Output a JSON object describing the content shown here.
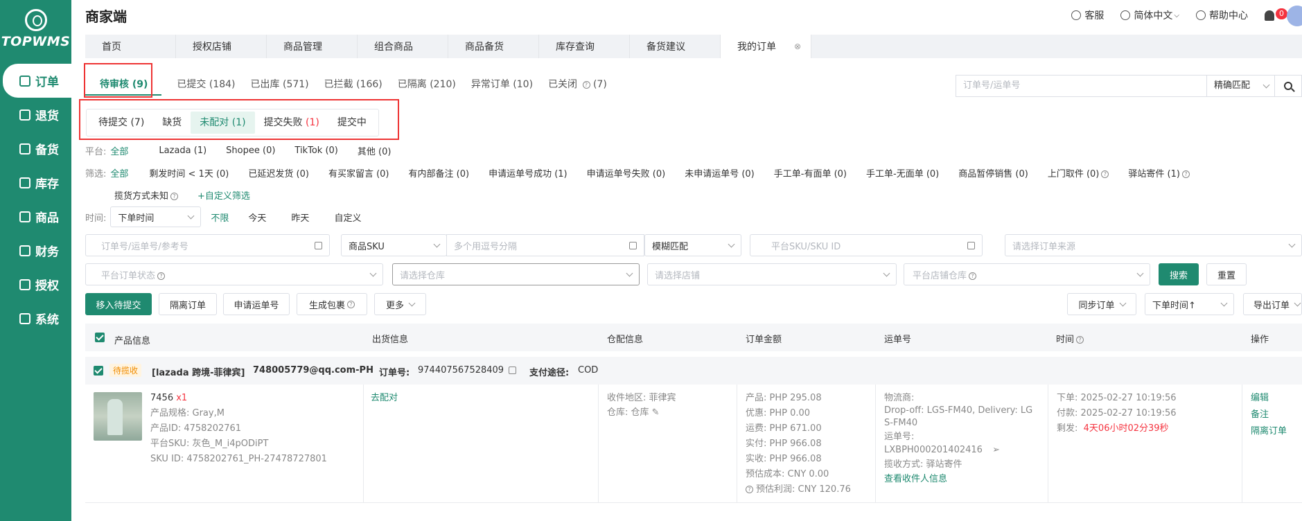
{
  "logo": {
    "text": "TOPWMS"
  },
  "sidebar": {
    "items": [
      {
        "label": "订单",
        "active": true
      },
      {
        "label": "退货"
      },
      {
        "label": "备货"
      },
      {
        "label": "库存"
      },
      {
        "label": "商品"
      },
      {
        "label": "财务"
      },
      {
        "label": "授权"
      },
      {
        "label": "系统"
      }
    ]
  },
  "header": {
    "title": "商家端",
    "service": "客服",
    "language": "简体中文",
    "help": "帮助中心",
    "notification_count": "0"
  },
  "page_tabs": [
    "首页",
    "授权店铺",
    "商品管理",
    "组合商品",
    "商品备货",
    "库存查询",
    "备货建议",
    "我的订单"
  ],
  "status_tabs": [
    "待审核 (9)",
    "已提交 (184)",
    "已出库 (571)",
    "已拦截 (166)",
    "已隔离 (210)",
    "异常订单 (10)",
    "已关闭",
    "(7)"
  ],
  "top_search": {
    "placeholder": "订单号/运单号",
    "mode": "精确匹配"
  },
  "sub_tabs": [
    "待提交 (7)",
    "缺货",
    "未配对 (1)",
    "提交失败",
    "(1)",
    "提交中"
  ],
  "platform_filter": {
    "label": "平台:",
    "options": [
      "全部",
      "Lazada (1)",
      "Shopee (0)",
      "TikTok (0)",
      "其他 (0)"
    ]
  },
  "screen_filter": {
    "label": "筛选:",
    "options": [
      "全部",
      "剩发时间 < 1天 (0)",
      "已延迟发货 (0)",
      "有买家留言 (0)",
      "有内部备注 (0)",
      "申请运单号成功 (1)",
      "申请运单号失败 (0)",
      "未申请运单号 (0)",
      "手工单-有面单 (0)",
      "手工单-无面单 (0)",
      "商品暂停销售 (0)",
      "上门取件 (0)",
      "驿站寄件 (1)"
    ],
    "row2": [
      "揽货方式未知",
      "+自定义筛选"
    ]
  },
  "time_filter": {
    "label": "时间:",
    "select": "下单时间",
    "options": [
      "不限",
      "今天",
      "昨天",
      "自定义"
    ]
  },
  "search_fields": {
    "order_placeholder": "订单号/运单号/参考号",
    "sku_select": "商品SKU",
    "sku_placeholder": "多个用逗号分隔",
    "match_select": "模糊匹配",
    "platform_sku_placeholder": "平台SKU/SKU ID",
    "source_placeholder": "请选择订单来源",
    "platform_status_placeholder": "平台订单状态",
    "warehouse_placeholder": "请选择仓库",
    "store_placeholder": "请选择店铺",
    "store_warehouse_placeholder": "平台店铺仓库",
    "search_btn": "搜索",
    "reset_btn": "重置"
  },
  "actions": {
    "move_pending": "移入待提交",
    "isolate": "隔离订单",
    "apply_waybill": "申请运单号",
    "gen_package": "生成包裹",
    "more": "更多",
    "sync": "同步订单",
    "sort": "下单时间↑",
    "export": "导出订单"
  },
  "table": {
    "headers": [
      "产品信息",
      "出货信息",
      "仓配信息",
      "订单金额",
      "运单号",
      "时间",
      "操作"
    ]
  },
  "order": {
    "status_tag": "待揽收",
    "store": "[lazada 跨境-菲律宾]",
    "account": "748005779@qq.com-PH",
    "order_no_label": "订单号:",
    "order_no": "974407567528409",
    "pay_label": "支付途径:",
    "pay": "COD",
    "product": {
      "name": "7456",
      "qty": "x1",
      "spec": "产品规格:  Gray,M",
      "id": "产品ID:  4758202761",
      "platform_sku": "平台SKU:  灰色_M_i4pODiPT",
      "sku_id": "SKU ID:  4758202761_PH-27478727801"
    },
    "ship": "去配对",
    "wh": {
      "region": "收件地区:  菲律宾",
      "warehouse": "仓库:  仓库"
    },
    "amount": [
      "产品:  PHP 295.08",
      "优惠:  PHP 0.00",
      "运费:  PHP 671.00",
      "实付:  PHP 966.08",
      "实收:  PHP 966.08",
      "预估成本:  CNY 0.00",
      "预估利润:  CNY 120.76"
    ],
    "waybill": {
      "carrier_label": "物流商:",
      "carrier_1": "Drop-off: LGS-FM40, Delivery: LG",
      "carrier_2": "S-FM40",
      "no_label": "运单号:",
      "no": "LXBPH000201402416",
      "pickup": "揽收方式:  驿站寄件",
      "view": "查看收件人信息"
    },
    "time": {
      "order": "下单:  2025-02-27 10:19:56",
      "pay": "付款:  2025-02-27 10:19:56",
      "remain_label": "剩发:",
      "remain": "4天06小时02分39秒"
    },
    "ops": [
      "编辑",
      "备注",
      "隔离订单"
    ]
  }
}
